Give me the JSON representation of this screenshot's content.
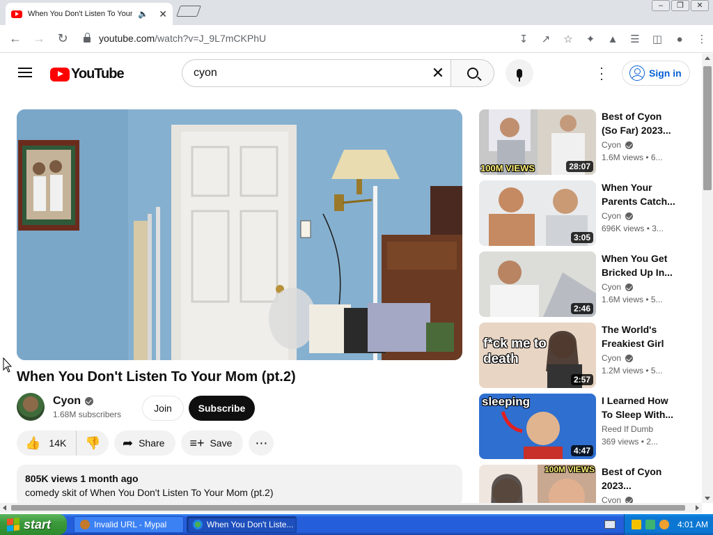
{
  "browser": {
    "tab_title": "When You Don't Listen To Your",
    "url_host": "youtube.com",
    "url_path": "/watch?v=J_9L7mCKPhU"
  },
  "yt": {
    "logo_text": "YouTube",
    "search_value": "cyon",
    "signin_label": "Sign in"
  },
  "video": {
    "title": "When You Don't Listen To Your Mom (pt.2)",
    "channel": "Cyon",
    "subscribers": "1.68M subscribers",
    "join_label": "Join",
    "subscribe_label": "Subscribe",
    "likes": "14K",
    "share_label": "Share",
    "save_label": "Save",
    "desc_meta": "805K views  1 month ago",
    "desc_text": "comedy skit of When You Don't Listen To Your Mom (pt.2)"
  },
  "recommendations": [
    {
      "title": "Best of Cyon (So Far) 2023...",
      "channel": "Cyon",
      "verified": true,
      "views": "1.6M views  • 6...",
      "duration": "28:07",
      "overlay": "100M VIEWS"
    },
    {
      "title": "When Your Parents Catch...",
      "channel": "Cyon",
      "verified": true,
      "views": "696K views  • 3...",
      "duration": "3:05",
      "overlay": ""
    },
    {
      "title": "When You Get Bricked Up In...",
      "channel": "Cyon",
      "verified": true,
      "views": "1.6M views  • 5...",
      "duration": "2:46",
      "overlay": ""
    },
    {
      "title": "The World's Freakiest Girl",
      "channel": "Cyon",
      "verified": true,
      "views": "1.2M views  • 5...",
      "duration": "2:57",
      "overlay": "f*ck me to death"
    },
    {
      "title": "I Learned How To Sleep With...",
      "channel": "Reed If Dumb",
      "verified": false,
      "views": "369 views  • 2...",
      "duration": "4:47",
      "overlay": "sleeping"
    },
    {
      "title": "Best of Cyon 2023...",
      "channel": "Cyon",
      "verified": true,
      "views": "",
      "duration": "",
      "overlay": "100M VIEWS"
    }
  ],
  "taskbar": {
    "start_label": "start",
    "task1_label": "Invalid URL - Mypal",
    "task2_label": "When You Don't Liste...",
    "clock": "4:01 AM"
  },
  "colors": {
    "yt_red": "#ff0000",
    "link_blue": "#065fd4",
    "xp_blue": "#245edb",
    "xp_green": "#3c9a3c"
  },
  "icons": {
    "back": "arrow-left-icon",
    "forward": "arrow-right-icon",
    "reload": "reload-icon",
    "like": "thumbs-up-icon",
    "dislike": "thumbs-down-icon"
  }
}
